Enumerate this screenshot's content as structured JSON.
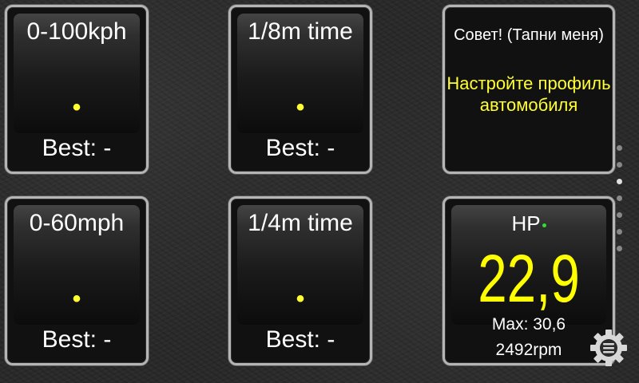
{
  "tiles": {
    "accel_100": {
      "title": "0-100kph",
      "indicator": "•",
      "best": "Best: -"
    },
    "eighth_mile": {
      "title": "1/8m time",
      "indicator": "•",
      "best": "Best: -"
    },
    "accel_60": {
      "title": "0-60mph",
      "indicator": "•",
      "best": "Best: -"
    },
    "quarter_mile": {
      "title": "1/4m time",
      "indicator": "•",
      "best": "Best: -"
    }
  },
  "tip": {
    "title": "Совет! (Тапни меня)",
    "text": "Настройте профиль автомобиля"
  },
  "hp": {
    "label": "HP",
    "value": "22,9",
    "max": "Max: 30,6",
    "rpm": "2492rpm",
    "status_color": "#33dd33"
  },
  "pager": {
    "pages": 7,
    "active_index": 3
  },
  "menu": {
    "icon": "gear-menu-icon"
  },
  "colors": {
    "accent": "#ffff33",
    "frame": "#b5b5b5"
  }
}
